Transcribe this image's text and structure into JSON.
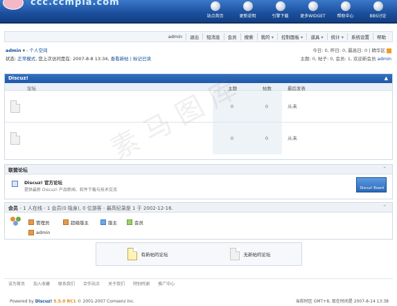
{
  "header": {
    "logo_text": "ccc.ccmpia.com",
    "nav": [
      {
        "label": "站点首页",
        "icon": "home-icon"
      },
      {
        "label": "更新说明",
        "icon": "lightbulb-icon"
      },
      {
        "label": "引擎下载",
        "icon": "download-icon"
      },
      {
        "label": "更多WIDGET",
        "icon": "gear-icon"
      },
      {
        "label": "帮助中心",
        "icon": "help-icon"
      },
      {
        "label": "BBS讨论",
        "icon": "bbs-icon"
      }
    ]
  },
  "toolbar": {
    "items": [
      "admin",
      "退出",
      "短消息",
      "会员",
      "搜索",
      "我的",
      "控制面板",
      "道具",
      "统计",
      "系统设置",
      "帮助"
    ]
  },
  "userinfo": {
    "username": "admin",
    "space_link": "- 个人空间",
    "status_prefix": "状态:",
    "status_mode": "正常模式",
    "last_visit": ", 您上次访问是在: 2007-8-8 13:34,",
    "view_new": "查看新帖",
    "mark_read": "| 标记已读"
  },
  "stats": {
    "line1": "今日: 0, 昨日: 0, 最高日: 0 | 精华区",
    "line2": "主题: 0, 帖子: 0, 会员: 1, 欢迎新会员",
    "new_member": "admin"
  },
  "forum": {
    "category": "Discuz!",
    "headers": {
      "forum": "论坛",
      "topics": "主题",
      "posts": "帖数",
      "last_post": "最后发表"
    },
    "rows": [
      {
        "topics": "0",
        "posts": "0",
        "last_post": "从未"
      },
      {
        "topics": "0",
        "posts": "0",
        "last_post": "从未"
      }
    ]
  },
  "league": {
    "title": "联盟论坛",
    "site_name": "Discuz! 官方论坛",
    "site_desc": "提供最新 Discuz! 产品新闻、软件下载与技术交流",
    "logo_text": "Discuz! Board"
  },
  "members": {
    "title": "会员",
    "summary": "- 1 人在线 - 1 会员(0 隐身), 0 位游客 - 最高纪录是 1 于 2002-12-16.",
    "legend": [
      "管理员",
      "超级版主",
      "版主",
      "会员"
    ],
    "online_user": "admin"
  },
  "icon_legend": {
    "new": "有新帖的论坛",
    "no_new": "无新帖的论坛"
  },
  "footer": {
    "links": [
      "设为首页",
      "加入收藏",
      "联系我们",
      "合作站点",
      "关于我们",
      "特别鸣谢",
      "推广中心"
    ],
    "copyright_prefix": "Powered by",
    "product": "Discuz!",
    "version": "5.5.0 RC1",
    "copyright_rest": "© 2001-2007 Comsenz Inc.",
    "time_info": "当前时区 GMT+8, 现在时间是 2007-8-14 13:38"
  },
  "watermark": "素 马 图 库",
  "colors": {
    "accent": "#1f58a8",
    "link": "#0b4b97"
  }
}
